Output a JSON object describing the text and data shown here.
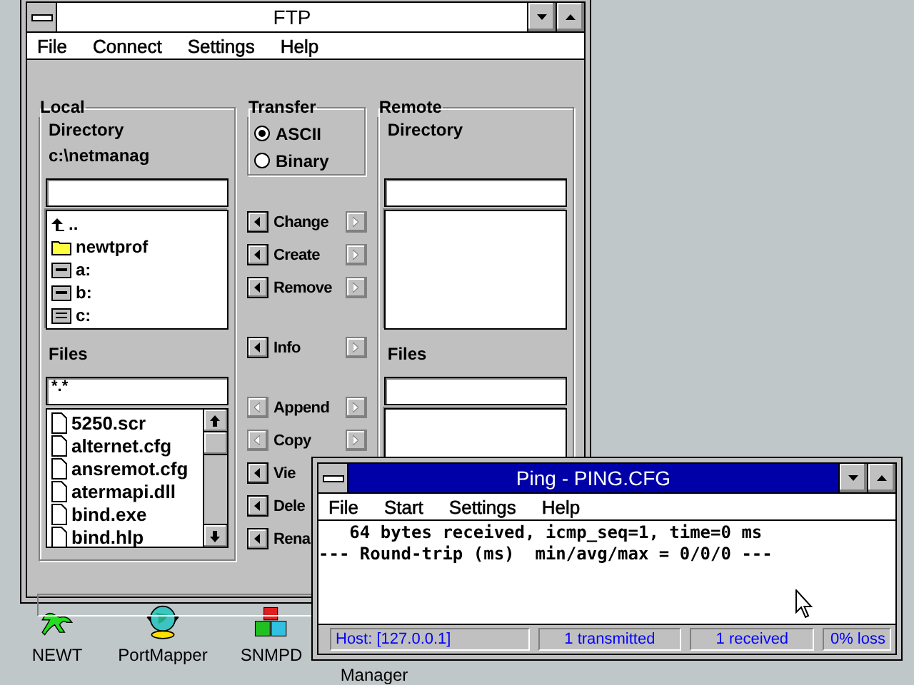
{
  "desktop_icons": [
    {
      "label": "NEWT",
      "kind": "lizard"
    },
    {
      "label": "PortMapper",
      "kind": "globe"
    },
    {
      "label": "SNMPD",
      "kind": "blocks"
    },
    {
      "label": "Manager",
      "kind": "hidden"
    }
  ],
  "ftp_window": {
    "title": "FTP",
    "active": false,
    "menu": [
      "File",
      "Connect",
      "Settings",
      "Help"
    ],
    "local": {
      "label": "Local",
      "directory_label": "Directory",
      "directory": "c:\\netmanag",
      "dir_items": [
        {
          "name": "..",
          "kind": "up"
        },
        {
          "name": "newtprof",
          "kind": "folder"
        },
        {
          "name": "a:",
          "kind": "floppy"
        },
        {
          "name": "b:",
          "kind": "floppy"
        },
        {
          "name": "c:",
          "kind": "disk"
        }
      ],
      "files_label": "Files",
      "filter": "*.*",
      "files": [
        "5250.scr",
        "alternet.cfg",
        "ansremot.cfg",
        "atermapi.dll",
        "bind.exe",
        "bind.hlp"
      ]
    },
    "transfer": {
      "label": "Transfer",
      "options": [
        {
          "label": "ASCII",
          "selected": true
        },
        {
          "label": "Binary",
          "selected": false
        }
      ]
    },
    "action_groups": [
      [
        {
          "label": "Change",
          "left_enabled": true,
          "right_enabled": false
        },
        {
          "label": "Create",
          "left_enabled": true,
          "right_enabled": false
        },
        {
          "label": "Remove",
          "left_enabled": true,
          "right_enabled": false
        }
      ],
      [
        {
          "label": "Info",
          "left_enabled": true,
          "right_enabled": false
        }
      ],
      [
        {
          "label": "Append",
          "left_enabled": false,
          "right_enabled": false
        },
        {
          "label": "Copy",
          "left_enabled": false,
          "right_enabled": false
        },
        {
          "label": "Vie",
          "left_enabled": true
        },
        {
          "label": "Dele",
          "left_enabled": true
        },
        {
          "label": "Rena",
          "left_enabled": true
        }
      ]
    ],
    "remote": {
      "label": "Remote",
      "directory_label": "Directory",
      "files_label": "Files"
    }
  },
  "ping_window": {
    "title": "Ping - PING.CFG",
    "active": true,
    "menu": [
      "File",
      "Start",
      "Settings",
      "Help"
    ],
    "output": [
      "   64 bytes received, icmp_seq=1, time=0 ms",
      "--- Round-trip (ms)  min/avg/max = 0/0/0 ---"
    ],
    "status": [
      "Host:  [127.0.0.1]",
      "1 transmitted",
      "1 received",
      "0% loss"
    ]
  }
}
